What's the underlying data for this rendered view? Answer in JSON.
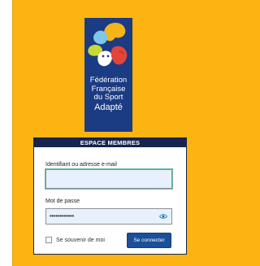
{
  "logo": {
    "line1": "Fédération",
    "line2": "Française",
    "line3": "du Sport",
    "line4": "Adapté"
  },
  "login": {
    "header": "ESPACE MEMBRES",
    "username_label": "Identifiant ou adresse e-mail",
    "username_value": "",
    "password_label": "Mot de passe",
    "password_value": "••••••••••••",
    "remember_label": "Se souvenir de moi",
    "remember_checked": false,
    "submit_label": "Se connecter",
    "show_password_icon": "eye-icon"
  },
  "colors": {
    "background": "#fbb412",
    "logo_background": "#1b3b83",
    "card_header": "#16244f",
    "button": "#1a4f99"
  }
}
